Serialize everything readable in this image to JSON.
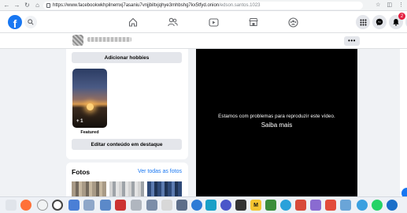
{
  "browser": {
    "url_host": "https://www.facebookwkhpilnemxj7asaniu7vnjjbiltxjqhye3mhbshg7kx5tfyd.onion",
    "url_path": "/edson.santos.1023"
  },
  "notifications": {
    "badge_count": "2"
  },
  "left_card": {
    "add_hobbies_label": "Adicionar hobbies",
    "featured_count": "+ 1",
    "featured_label": "Featured",
    "edit_featured_label": "Editar conteúdo em destaque"
  },
  "photos": {
    "title": "Fotos",
    "see_all_label": "Ver todas as fotos"
  },
  "video": {
    "error_message": "Estamos com problemas para reproduzir este vídeo.",
    "learn_more_label": "Saiba mais"
  },
  "icons": {
    "browser": [
      "back-arrow-icon",
      "forward-arrow-icon",
      "reload-icon",
      "home-icon",
      "lock-icon",
      "star-icon",
      "extension-icon",
      "menu-icon"
    ],
    "nav": [
      "facebook-logo",
      "search-icon",
      "home-icon",
      "friends-icon",
      "watch-icon",
      "marketplace-icon",
      "groups-icon",
      "menu-grid-icon",
      "messenger-icon",
      "bell-icon",
      "account-icon"
    ]
  },
  "colors": {
    "facebook_blue": "#1877f2",
    "page_background": "#f0f2f5",
    "button_gray": "#e4e6eb",
    "notification_red": "#e41e3f",
    "video_background": "#000000"
  }
}
